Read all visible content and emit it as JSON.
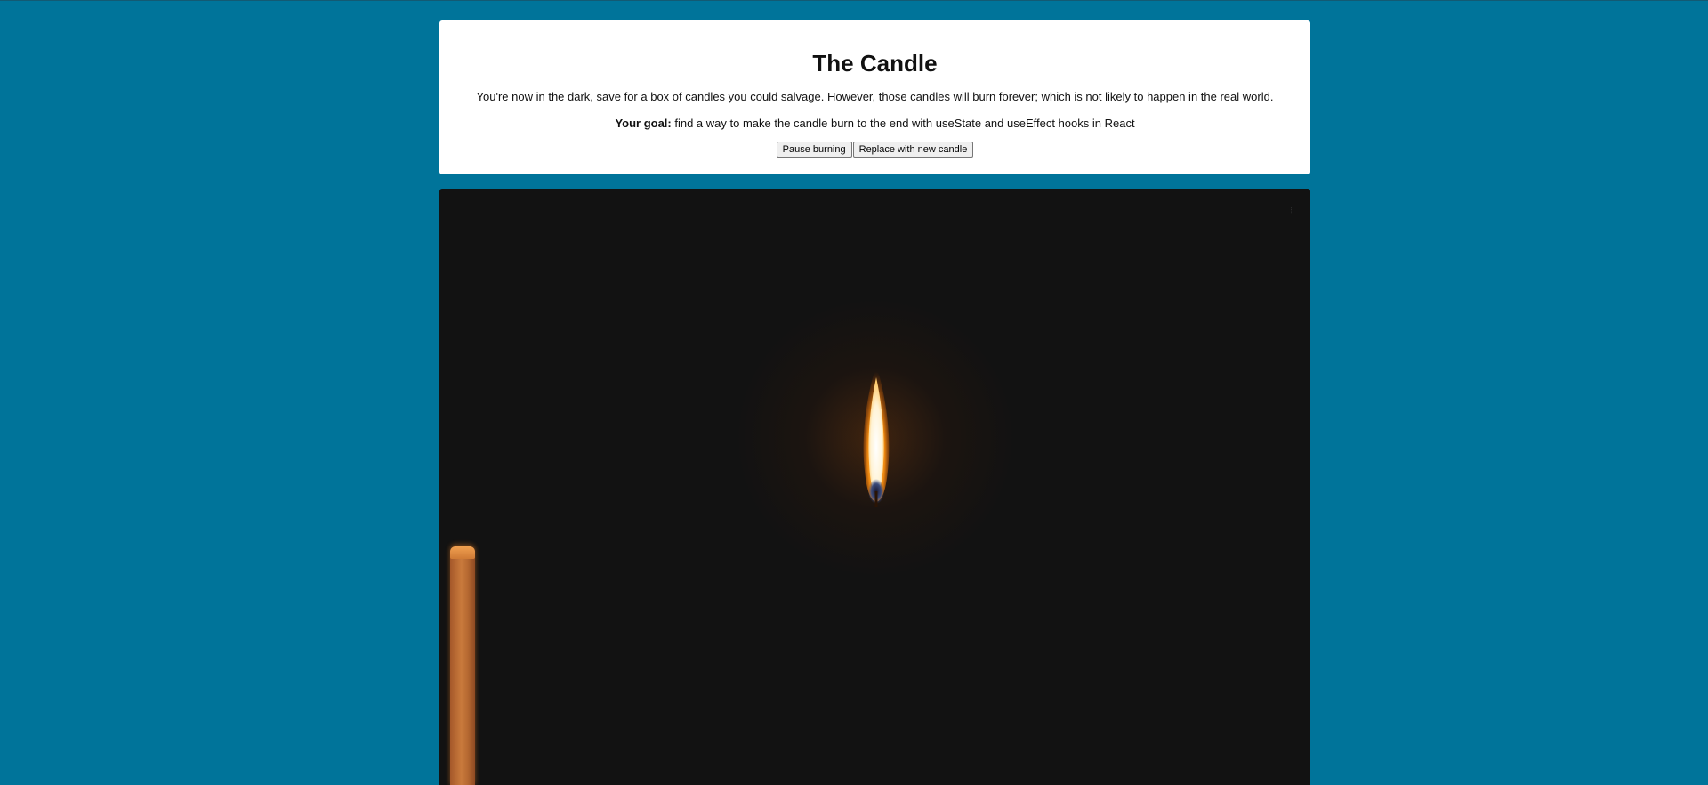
{
  "header": {
    "title": "The Candle",
    "description": "You're now in the dark, save for a box of candles you could salvage. However, those candles will burn forever; which is not likely to happen in the real world.",
    "goal_label": "Your goal:",
    "goal_text": " find a way to make the candle burn to the end with useState and useEffect hooks in React"
  },
  "controls": {
    "pause_label": "Pause burning",
    "replace_label": "Replace with new candle"
  },
  "stage": {
    "menu_icon": "menu-dot-icon"
  },
  "colors": {
    "page_background": "#00749a",
    "card_background": "#ffffff",
    "stage_background": "#121212",
    "candle_wax": "#c97a3c",
    "flame_core": "#ffffff",
    "flame_outer": "#f08a10"
  }
}
